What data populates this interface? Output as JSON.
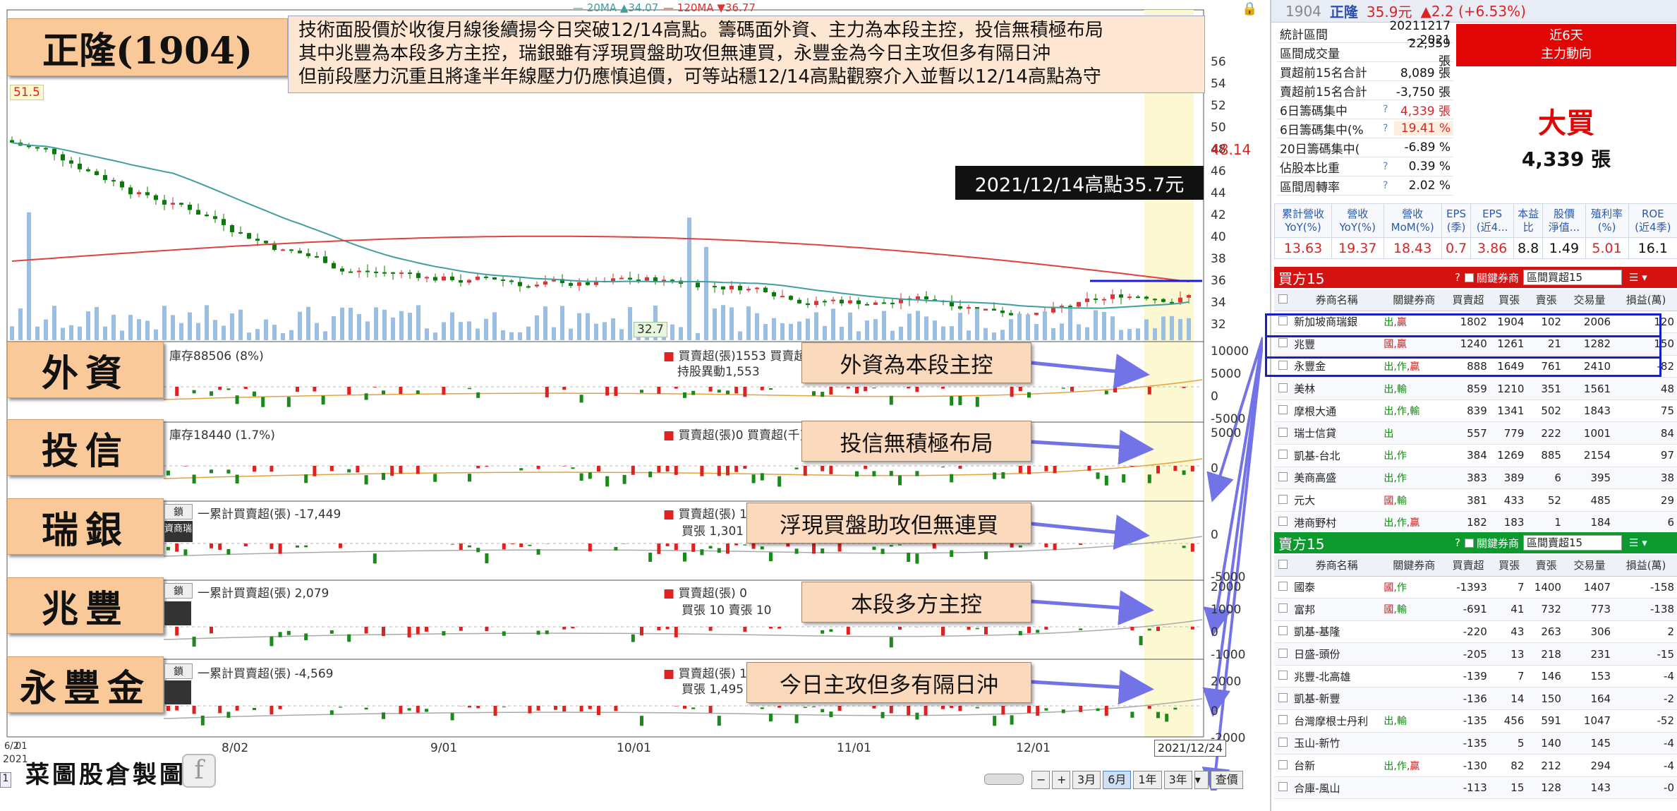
{
  "stock": {
    "title": "正隆(1904)",
    "commentary": [
      "技術面股價於收復月線後續揚今日突破12/14高點。籌碼面外資、主力為本段主控，投信無積極布局",
      "其中兆豐為本段多方主控，瑞銀雖有浮現買盤助攻但無連買，永豐金為今日主攻但多有隔日沖",
      "但前段壓力沉重且將逢半年線壓力仍應慎追價，可等站穩12/14高點觀察介入並暫以12/14高點為守"
    ],
    "high_note": "2021/12/14高點35.7元",
    "max_label": "51.5",
    "min_label": "32.7",
    "current_price_label": "48.14"
  },
  "legend": {
    "ma20": "20MA ▲34.07",
    "ma120": "120MA ▼36.77"
  },
  "price_axis": [
    "56",
    "54",
    "52",
    "50",
    "48",
    "46",
    "44",
    "42",
    "40",
    "38",
    "36",
    "34",
    "32"
  ],
  "panels": [
    {
      "label": "外資",
      "head": "庫存88506 (8%)",
      "head2": "買賣超(張)1553 買賣超(",
      "head3": "持股異動1,553",
      "annot": "外資為本段主控",
      "axis": [
        "10000",
        "5000",
        "0",
        "-5000"
      ]
    },
    {
      "label": "投信",
      "head": "庫存18440 (1.7%)",
      "head2": "買賣超(張)0 買賣超(千)0",
      "head3": "",
      "annot": "投信無積極布局",
      "axis": [
        "5000",
        "0"
      ]
    },
    {
      "label": "瑞銀",
      "head": "一累計買賣超(張) -17,449",
      "head2": "買賣超(張) 1,",
      "head3": "買張 1,301 賣",
      "annot": "浮現買盤助攻但無連買",
      "axis": [
        "0",
        "-5000"
      ]
    },
    {
      "label": "兆豐",
      "head": "一累計買賣超(張) 2,079",
      "head2": "買賣超(張) 0",
      "head3": "買張 10 賣張 10",
      "annot": "本段多方主控",
      "axis": [
        "2000",
        "1000",
        "0",
        "-1000"
      ]
    },
    {
      "label": "永豐金",
      "head": "一累計買賣超(張) -4,569",
      "head2": "買賣超(張) 1,",
      "head3": "買張 1,495 賣",
      "annot": "今日主攻但多有隔日沖",
      "axis": [
        "2000",
        "0",
        "-2000"
      ]
    }
  ],
  "mini_btn": "鎖",
  "mini_btn2": "資商瑞",
  "dates": {
    "start": "6/2",
    "start2": "2021",
    "start3": "01",
    "d1": "8/02",
    "d2": "9/01",
    "d3": "10/01",
    "d4": "11/01",
    "d5": "12/01",
    "current": "2021/12/24"
  },
  "footer": {
    "logo": "菜圖股倉製圖",
    "page": "1",
    "fb": "f"
  },
  "toolbar": [
    "3月",
    "6月",
    "1年",
    "3年",
    "查價"
  ],
  "quote": {
    "code": "1904",
    "name": "正隆",
    "price": "35.9元",
    "change": "▲2.2 (+6.53%)"
  },
  "stats": [
    {
      "k": "統計區間",
      "v": "20211217 ~ 2021",
      "c": "#111"
    },
    {
      "k": "區間成交量",
      "v": "22,359 張",
      "c": "#111"
    },
    {
      "k": "買超前15名合計",
      "v": "8,089 張",
      "c": "#111"
    },
    {
      "k": "賣超前15名合計",
      "v": "-3,750 張",
      "c": "#111"
    },
    {
      "k": "6日籌碼集中",
      "v": "4,339 張",
      "c": "#d22",
      "q": "?"
    },
    {
      "k": "6日籌碼集中(%",
      "v": "19.41 %",
      "c": "#d22",
      "q": "?",
      "hl": true
    },
    {
      "k": "20日籌碼集中(",
      "v": "-6.89 %",
      "c": "#111"
    },
    {
      "k": "佔股本比重",
      "v": "0.39 %",
      "c": "#111",
      "q": "?"
    },
    {
      "k": "區間周轉率",
      "v": "2.02 %",
      "c": "#111",
      "q": "?"
    }
  ],
  "main_force": {
    "head1": "近6天",
    "head2": "主力動向",
    "verdict": "大買",
    "amount": "4,339 張"
  },
  "fin": {
    "headers": [
      [
        "累計營收",
        "YoY(%)"
      ],
      [
        "營收",
        "YoY(%)"
      ],
      [
        "營收",
        "MoM(%)"
      ],
      [
        "EPS",
        "(季)"
      ],
      [
        "EPS",
        "(近4..."
      ],
      [
        "本益",
        "比"
      ],
      [
        "股價",
        "淨值..."
      ],
      [
        "殖利率",
        "(%)"
      ],
      [
        "ROE",
        "(近4季)"
      ]
    ],
    "values": [
      "13.63",
      "19.37",
      "18.43",
      "0.7",
      "3.86",
      "8.8",
      "1.49",
      "5.01",
      "16.1"
    ]
  },
  "buy": {
    "title": "買方15",
    "q": "?",
    "lbl": "關鍵券商",
    "sel": "區間買超15",
    "cols": [
      "券商名稱",
      "關鍵券商",
      "買賣超",
      "買張",
      "賣張",
      "交易量",
      "損益(萬)"
    ],
    "rows": [
      [
        "新加坡商瑞銀",
        "出,贏",
        "1802",
        "1904",
        "102",
        "2006",
        "120"
      ],
      [
        "兆豐",
        "國,贏",
        "1240",
        "1261",
        "21",
        "1282",
        "150"
      ],
      [
        "永豐金",
        "出,作,贏",
        "888",
        "1649",
        "761",
        "2410",
        "-82"
      ],
      [
        "美林",
        "出,輸",
        "859",
        "1210",
        "351",
        "1561",
        "48"
      ],
      [
        "摩根大通",
        "出,作,輸",
        "839",
        "1341",
        "502",
        "1843",
        "75"
      ],
      [
        "瑞士信貸",
        "出",
        "557",
        "779",
        "222",
        "1001",
        "84"
      ],
      [
        "凱基-台北",
        "出,作",
        "384",
        "1269",
        "885",
        "2154",
        "97"
      ],
      [
        "美商高盛",
        "出,作",
        "383",
        "389",
        "6",
        "395",
        "38"
      ],
      [
        "元大",
        "國,輸",
        "381",
        "433",
        "52",
        "485",
        "29"
      ],
      [
        "港商野村",
        "出,作,贏",
        "182",
        "183",
        "1",
        "184",
        "6"
      ]
    ]
  },
  "sell": {
    "title": "賣方15",
    "q": "?",
    "lbl": "關鍵券商",
    "sel": "區間賣超15",
    "cols": [
      "券商名稱",
      "關鍵券商",
      "買賣超",
      "買張",
      "賣張",
      "交易量",
      "損益(萬)"
    ],
    "rows": [
      [
        "國泰",
        "國,作",
        "-1393",
        "7",
        "1400",
        "1407",
        "-158"
      ],
      [
        "富邦",
        "國,輸",
        "-691",
        "41",
        "732",
        "773",
        "-138"
      ],
      [
        "凱基-基隆",
        "",
        "-220",
        "43",
        "263",
        "306",
        "2"
      ],
      [
        "日盛-頭份",
        "",
        "-205",
        "13",
        "218",
        "231",
        "-15"
      ],
      [
        "兆豐-北高雄",
        "",
        "-139",
        "7",
        "146",
        "153",
        "-4"
      ],
      [
        "凱基-新豐",
        "",
        "-136",
        "14",
        "150",
        "164",
        "-2"
      ],
      [
        "台灣摩根士丹利",
        "出,輸",
        "-135",
        "456",
        "591",
        "1047",
        "-52"
      ],
      [
        "玉山-新竹",
        "",
        "-135",
        "5",
        "140",
        "145",
        "-4"
      ],
      [
        "台新",
        "出,作,贏",
        "-130",
        "82",
        "212",
        "294",
        "-4"
      ],
      [
        "合庫-風山",
        "",
        "-113",
        "15",
        "128",
        "143",
        "-0"
      ]
    ]
  }
}
